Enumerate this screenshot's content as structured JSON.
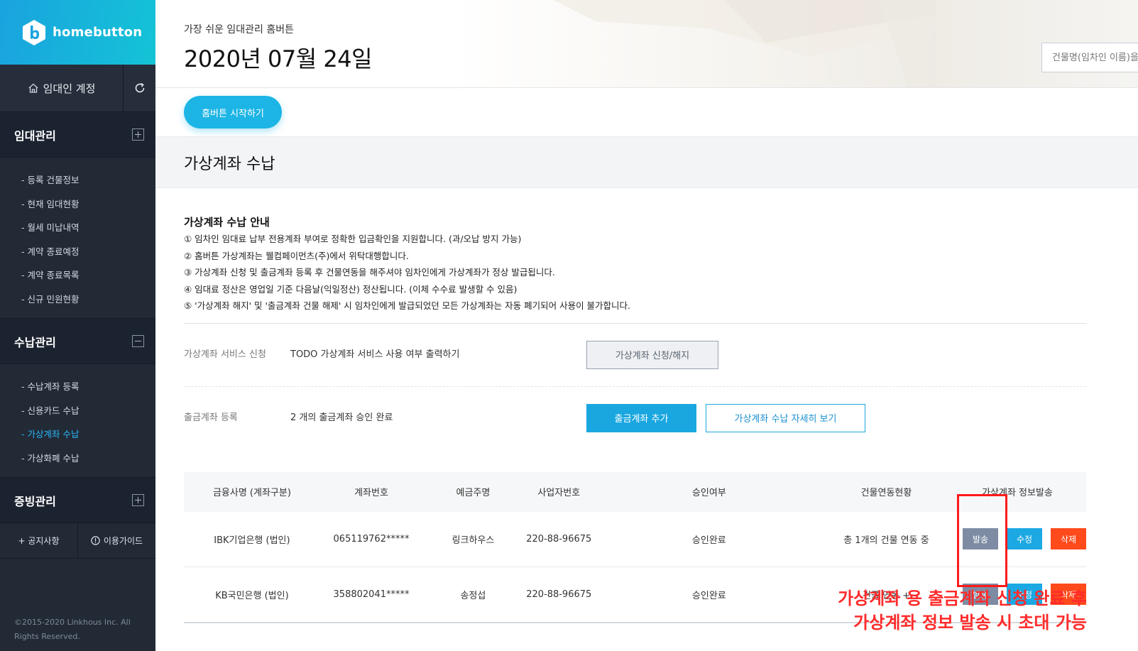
{
  "brand": {
    "name": "homebutton"
  },
  "sidebar": {
    "account_label": "임대인 계정",
    "sections": [
      {
        "title": "임대관리",
        "expanded": false,
        "items": [
          "- 등록 건물정보",
          "- 현재 임대현황",
          "- 월세 미납내역",
          "- 계약 종료예정",
          "- 계약 종료목록",
          "- 신규 민원현황"
        ]
      },
      {
        "title": "수납관리",
        "expanded": true,
        "items": [
          "- 수납계좌 등록",
          "- 신용카드 수납",
          "- 가상계좌 수납",
          "- 가상화폐 수납"
        ],
        "active_index": 2
      },
      {
        "title": "증빙관리",
        "expanded": false,
        "items": []
      }
    ],
    "bottom_links": [
      "+ 공지사항",
      "이용가이드"
    ],
    "copyright": "©2015-2020 Linkhous Inc. All Rights Reserved."
  },
  "header": {
    "tagline": "가장 쉬운 임대관리 홈버튼",
    "date": "2020년 07월 24일",
    "search_placeholder": "건물명(임차인 이름)을"
  },
  "start_button": "홈버튼 시작하기",
  "section_title": "가상계좌 수납",
  "guide": {
    "title": "가상계좌 수납 안내",
    "lines": [
      "① 임차인 임대료 납부 전용계좌 부여로 정확한 입금확인을 지원합니다. (과/오납 방지 가능)",
      "② 홈버튼 가상계좌는 웰컴페이먼츠(주)에서 위탁대행합니다.",
      "③ 가상계좌 신청 및 출금계좌 등록 후 건물연동을 해주셔야 임차인에게 가상계좌가 정상 발급됩니다.",
      "④ 임대료 정산은 영업일 기준 다음날(익일정산) 정산됩니다. (이체 수수료 발생할 수 있음)",
      "⑤ '가상계좌 해지' 및 '출금계좌 건물 해제' 시 임차인에게 발급되었던 모든 가상계좌는 자동 폐기되어 사용이 불가합니다."
    ]
  },
  "service_row": {
    "label": "가상계좌 서비스 신청",
    "value": "TODO 가상계좌 서비스 사용 여부 출력하기",
    "button": "가상계좌 신청/해지"
  },
  "withdraw_row": {
    "label": "출금계좌 등록",
    "value": "2 개의 출금계좌 승인 완료",
    "add_button": "출금계좌 추가",
    "detail_button": "가상계좌 수납 자세히 보기"
  },
  "table": {
    "headers": [
      "금융사명 (계좌구분)",
      "계좌번호",
      "예금주명",
      "사업자번호",
      "승인여부",
      "건물연동현황",
      "가상계좌 정보발송"
    ],
    "rows": [
      {
        "bank": "IBK기업은행 (법인)",
        "account": "065119762*****",
        "holder": "링크하우스",
        "biz_no": "220-88-96675",
        "status": "승인완료",
        "link": "총 1개의 건물 연동 중"
      },
      {
        "bank": "KB국민은행 (법인)",
        "account": "358802041*****",
        "holder": "송정섭",
        "biz_no": "220-88-96675",
        "status": "승인완료",
        "link": "건물 연동 +"
      }
    ],
    "actions": {
      "send": "발송",
      "edit": "수정",
      "delete": "삭제"
    }
  },
  "annotation": {
    "line1": "가상계좌 용 출금계좌 신청 완료 후",
    "line2": "가상계좌 정보 발송 시 초대 가능",
    "color": "#ff2b2b"
  },
  "colors": {
    "accent": "#1aa7e0",
    "sidebar_bg": "#222a36",
    "active_menu": "#29b6f6",
    "delete": "#ff4a1c"
  },
  "icons": [
    "logo-icon",
    "home-icon",
    "refresh-icon",
    "plus-box-icon",
    "minus-box-icon",
    "info-circle-icon"
  ]
}
